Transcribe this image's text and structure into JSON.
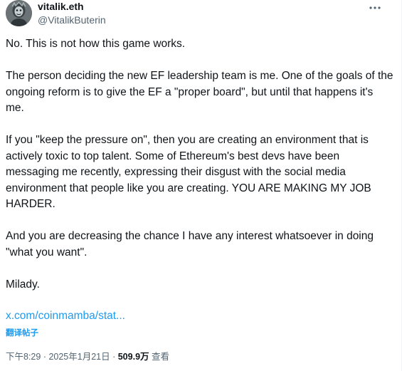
{
  "author": {
    "display_name": "vitalik.eth",
    "handle": "@VitalikButerin",
    "avatar_icon": "avatar-image"
  },
  "menu_icon": "more-dots-icon",
  "tweet": {
    "paragraphs": [
      "No. This is not how this game works.",
      "The person deciding the new EF leadership team is me. One of the goals of the ongoing reform is to give the EF a \"proper board\", but until that happens it's me.",
      "If you \"keep the pressure on\", then you are creating an environment that is actively toxic to top talent. Some of Ethereum's best devs have been messaging me recently, expressing their disgust with the social media environment that people like you are creating. YOU ARE MAKING MY JOB HARDER.",
      "And you are decreasing the chance I have any interest whatsoever in doing \"what you want\".",
      "Milady."
    ],
    "link_text": "x.com/coinmamba/stat...",
    "translate_label": "翻译帖子"
  },
  "meta": {
    "time": "下午8:29",
    "separator1": " · ",
    "date": "2025年1月21日",
    "separator2": " · ",
    "views_count": "509.9万",
    "views_label": " 查看"
  },
  "colors": {
    "link": "#1d9bf0",
    "secondary_text": "#536471",
    "primary_text": "#0f1419"
  }
}
